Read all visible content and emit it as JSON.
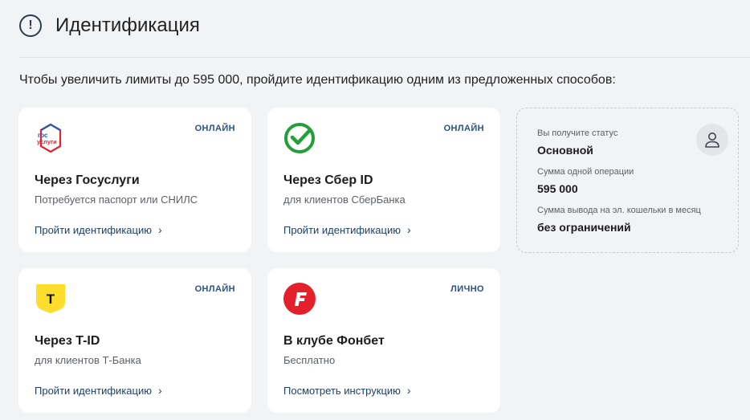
{
  "header": {
    "title": "Идентификация"
  },
  "subtitle": "Чтобы увеличить лимиты до 595 000, пройдите идентификацию одним из предложенных способов:",
  "cards": [
    {
      "name": "Через Госуслуги",
      "desc": "Потребуется паспорт или СНИЛС",
      "badge": "ОНЛАЙН",
      "link": "Пройти идентификацию",
      "logo_text_1": "гос",
      "logo_text_2": "услуги"
    },
    {
      "name": "Через Сбер ID",
      "desc": "для клиентов СберБанка",
      "badge": "ОНЛАЙН",
      "link": "Пройти идентификацию"
    },
    {
      "name": "Через T-ID",
      "desc": "для клиентов Т-Банка",
      "badge": "ОНЛАЙН",
      "link": "Пройти идентификацию",
      "logo_text": "T"
    },
    {
      "name": "В клубе Фонбет",
      "desc": "Бесплатно",
      "badge": "ЛИЧНО",
      "link": "Посмотреть инструкцию"
    }
  ],
  "status": {
    "label_status": "Вы получите статус",
    "value_status": "Основной",
    "label_operation": "Сумма одной операции",
    "value_operation": "595 000",
    "label_withdraw": "Сумма вывода на эл. кошельки в месяц",
    "value_withdraw": "без ограничений"
  },
  "colors": {
    "accent": "#1f3f66",
    "sber_green": "#21a038",
    "tbank_yellow": "#ffdd2d",
    "fonbet_red": "#e3202b"
  }
}
